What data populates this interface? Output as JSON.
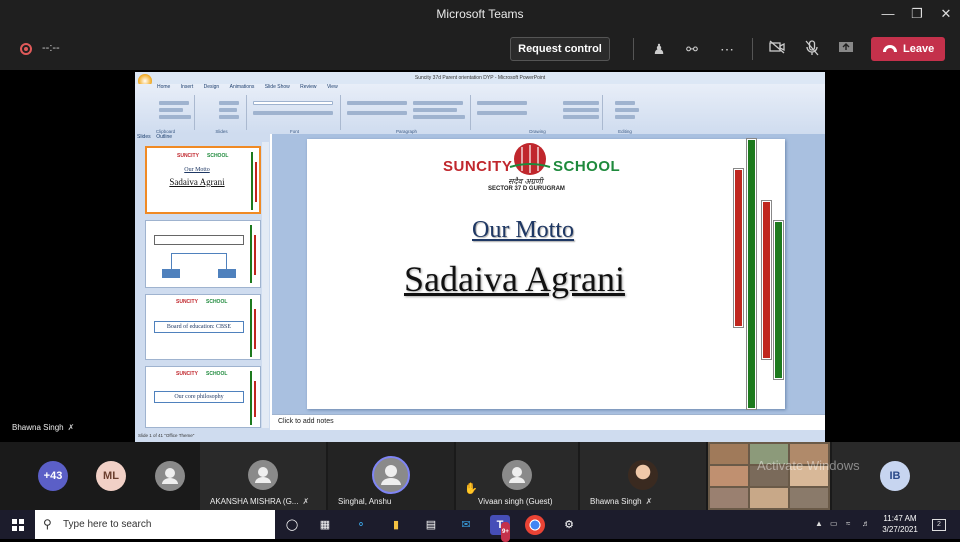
{
  "window": {
    "title": "Microsoft Teams"
  },
  "call": {
    "timer": "--:--",
    "request_control": "Request control",
    "leave": "Leave"
  },
  "ppt": {
    "title": "Suncity 37d Parent orientation DYP - Microsoft PowerPoint",
    "tabs": [
      "Home",
      "Insert",
      "Design",
      "Animations",
      "Slide Show",
      "Review",
      "View"
    ],
    "groups": [
      "Clipboard",
      "Slides",
      "Font",
      "Paragraph",
      "Drawing",
      "Editing"
    ],
    "side_tabs": [
      "Slides",
      "Outline"
    ],
    "thumb_texts": {
      "t1_a": "Our Motto",
      "t1_b": "Sadaiva Agrani",
      "t3": "Board of education: CBSE",
      "t4": "Our core philosophy"
    },
    "notes_placeholder": "Click to add notes",
    "status": "Slide 1 of 41   \"Office Theme\""
  },
  "slide": {
    "logo_left": "SUNCITY",
    "logo_right": "SCHOOL",
    "logo_hindi": "सदैव अग्रणी",
    "logo_sector": "SECTOR 37 D GURUGRAM",
    "motto": "Our Motto",
    "tagline": "Sadaiva Agrani",
    "bar_colors": {
      "red": "#c0271f",
      "green": "#1d7a1d"
    }
  },
  "presenter": {
    "name": "Bhawna Singh"
  },
  "participants": {
    "overflow": "+43",
    "ml_initials": "ML",
    "tiles": [
      {
        "name": "AKANSHA MISHRA (G..."
      },
      {
        "name": "Singhal, Anshu"
      },
      {
        "name": "Vivaan singh (Guest)"
      },
      {
        "name": "Bhawna Singh"
      }
    ],
    "ib_initials": "IB",
    "watermark": "Activate Windows"
  },
  "taskbar": {
    "search_placeholder": "Type here to search",
    "teams_badge": "9+",
    "time": "11:47 AM",
    "date": "3/27/2021",
    "notif_count": "2"
  }
}
